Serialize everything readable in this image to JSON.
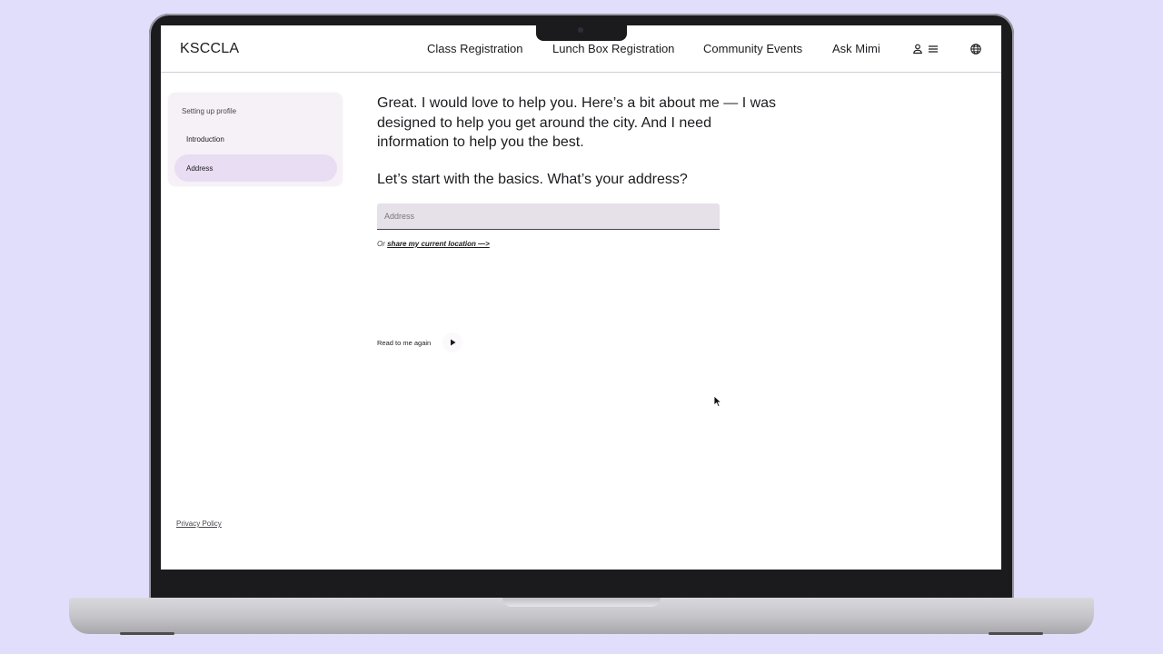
{
  "app": {
    "logo": "KSCCLA"
  },
  "nav": {
    "links": [
      "Class Registration",
      "Lunch Box Registration",
      "Community Events",
      "Ask Mimi"
    ],
    "icons": [
      "person-icon",
      "menu-icon",
      "globe-icon"
    ]
  },
  "sidebar": {
    "title": "Setting up profile",
    "items": [
      {
        "label": "Introduction",
        "active": false
      },
      {
        "label": "Address",
        "active": true
      }
    ]
  },
  "main": {
    "intro": "Great. I would love to help you. Here’s a bit about me — I was designed to help you get around the city. And I need information to help you the best.",
    "question": "Let’s start with the basics. What’s your address?",
    "address_field": {
      "placeholder": "Address",
      "value": ""
    },
    "or_text": "Or ",
    "share_link": "share my current location —>",
    "read_again": "Read to me again"
  },
  "footer": {
    "privacy": "Privacy Policy"
  },
  "colors": {
    "background": "#e0defa",
    "sidebar_bg": "#f5f1f7",
    "active_item": "#e8ddf3",
    "field_bg": "#e6e0e9",
    "text": "#1c1b1f"
  }
}
